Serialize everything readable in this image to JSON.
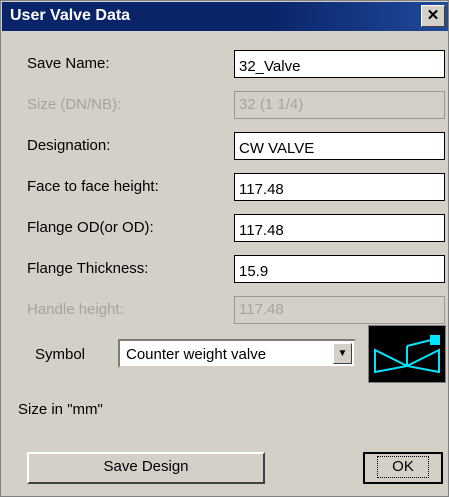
{
  "window": {
    "title": "User Valve Data"
  },
  "fields": [
    {
      "label": "Save Name:",
      "value": "32_Valve",
      "disabled": false
    },
    {
      "label": "Size (DN/NB):",
      "value": "32  (1 1/4)",
      "disabled": true
    },
    {
      "label": "Designation:",
      "value": "CW VALVE",
      "disabled": false
    },
    {
      "label": "Face to face height:",
      "value": "117.48",
      "disabled": false
    },
    {
      "label": "Flange OD(or OD):",
      "value": "117.48",
      "disabled": false
    },
    {
      "label": "Flange Thickness:",
      "value": "15.9",
      "disabled": false
    },
    {
      "label": "Handle height:",
      "value": "117.48",
      "disabled": true
    }
  ],
  "symbol": {
    "label": "Symbol",
    "selected": "Counter weight valve",
    "preview_icon": "counter-weight-valve-symbol",
    "preview_color": "#00e5ff"
  },
  "units_note": "Size in \"mm\"",
  "buttons": {
    "save_design": "Save Design",
    "ok": "OK"
  }
}
